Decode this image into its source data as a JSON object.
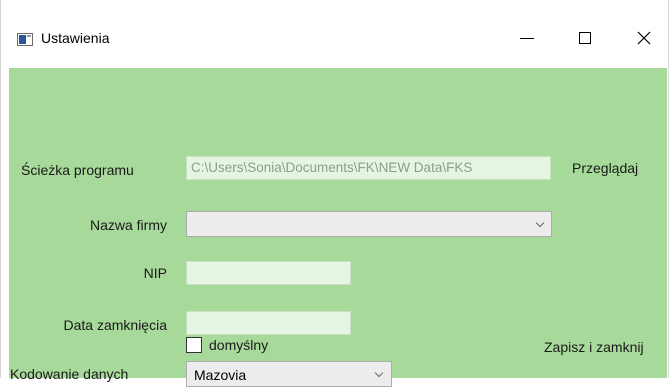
{
  "window": {
    "title": "Ustawienia",
    "controls": {
      "minimize": "minimize-icon",
      "maximize": "maximize-icon",
      "close": "close-icon"
    }
  },
  "form": {
    "path_label": "Ścieżka programu",
    "path_value": "C:\\Users\\Sonia\\Documents\\FK\\NEW Data\\FKS",
    "browse_label": "Przeglądaj",
    "company_label": "Nazwa firmy",
    "company_value": "",
    "nip_label": "NIP",
    "nip_value": "",
    "close_date_label": "Data zamknięcia",
    "close_date_value": "",
    "encoding_label": "Kodowanie danych",
    "encoding_value": "Mazovia",
    "default_checkbox_label": "domyślny",
    "default_checked": false,
    "save_close_label": "Zapisz i zamknij"
  },
  "colors": {
    "content_bg": "#a7d99a",
    "field_bg": "#e6f5e3",
    "combo_bg": "#ececec"
  }
}
